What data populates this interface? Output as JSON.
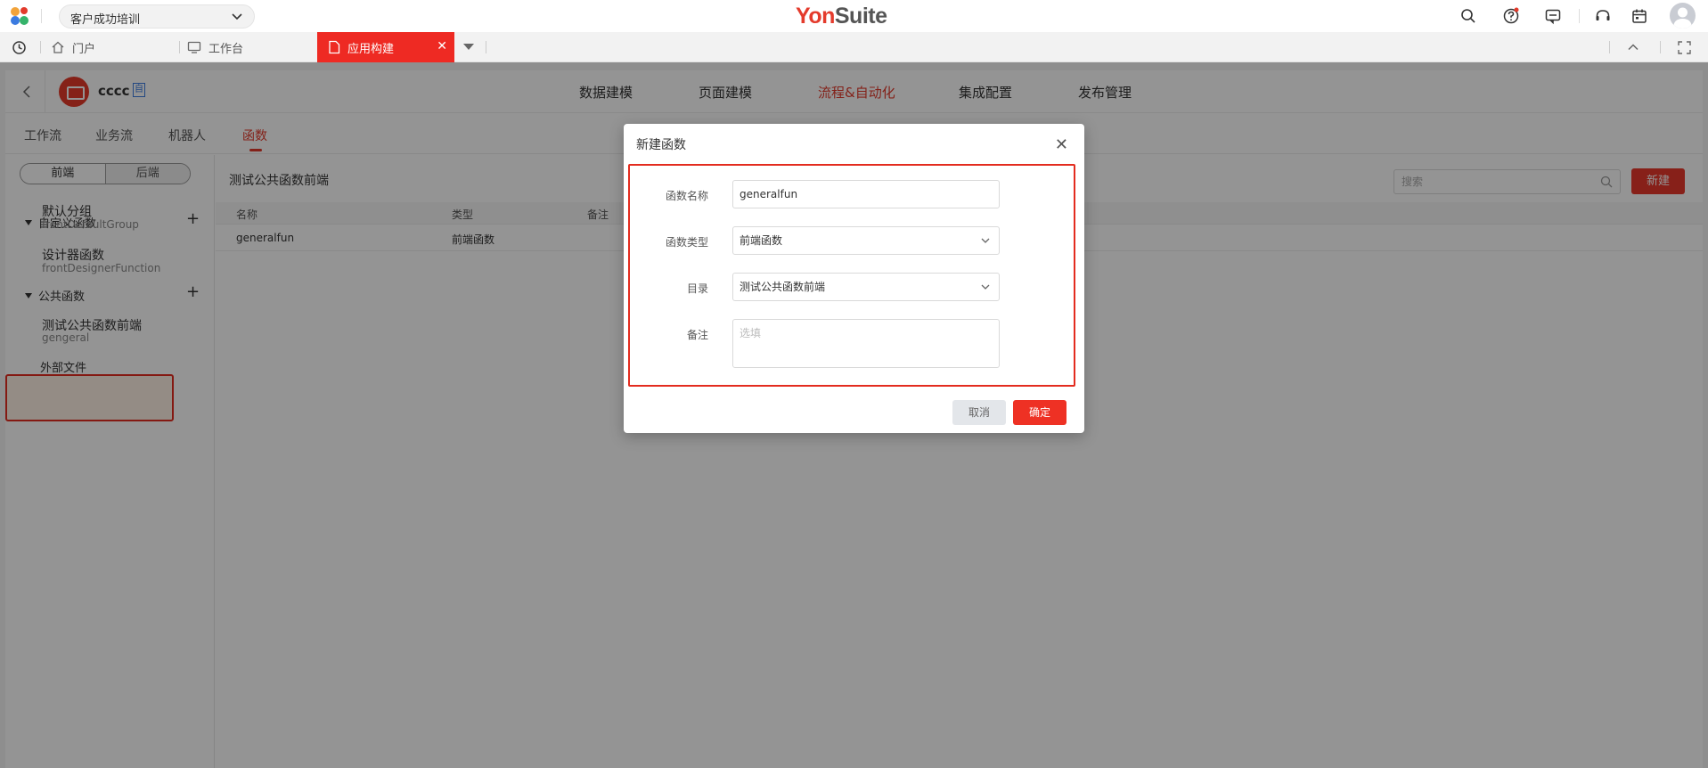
{
  "topbar": {
    "org_select": "客户成功培训",
    "logo_red": "Yon",
    "logo_gray": "Suite"
  },
  "tabs": [
    {
      "label": "门户"
    },
    {
      "label": "工作台"
    },
    {
      "label": "应用构建"
    }
  ],
  "app": {
    "name": "cccc",
    "tag": "自",
    "main_nav": [
      "数据建模",
      "页面建模",
      "流程&自动化",
      "集成配置",
      "发布管理"
    ],
    "sub_nav": [
      "工作流",
      "业务流",
      "机器人",
      "函数"
    ]
  },
  "sidebar": {
    "segment": [
      "前端",
      "后端"
    ],
    "group1": "自定义函数",
    "items1": [
      {
        "title": "默认分组",
        "code": "frontDefaultGroup"
      },
      {
        "title": "设计器函数",
        "code": "frontDesignerFunction"
      }
    ],
    "group2": "公共函数",
    "items2": [
      {
        "title": "测试公共函数前端",
        "code": "gengeral"
      }
    ],
    "external": "外部文件"
  },
  "content": {
    "title": "测试公共函数前端",
    "search_placeholder": "搜索",
    "new_label": "新建",
    "columns": [
      "名称",
      "类型",
      "备注"
    ],
    "rows": [
      {
        "name": "generalfun",
        "type": "前端函数",
        "note": ""
      }
    ]
  },
  "modal": {
    "title": "新建函数",
    "fields": {
      "name_label": "函数名称",
      "name_value": "generalfun",
      "type_label": "函数类型",
      "type_value": "前端函数",
      "dir_label": "目录",
      "dir_value": "测试公共函数前端",
      "note_label": "备注",
      "note_placeholder": "选填"
    },
    "cancel": "取消",
    "ok": "确定"
  },
  "colors": {
    "accent": "#e8382c",
    "highlight_border": "#e32c1f",
    "selected_bg": "#fff2e6"
  }
}
